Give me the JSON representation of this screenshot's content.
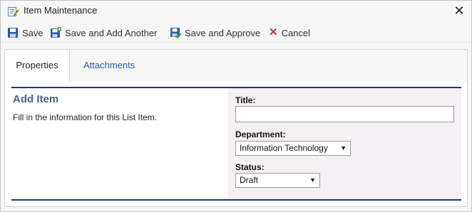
{
  "window": {
    "title": "Item Maintenance",
    "close_symbol": "✕"
  },
  "toolbar": {
    "save_label": "Save",
    "save_add_label": "Save and Add Another",
    "save_approve_label": "Save and Approve",
    "cancel_label": "Cancel",
    "cancel_symbol": "✕"
  },
  "tabs": [
    {
      "label": "Properties",
      "active": true
    },
    {
      "label": "Attachments",
      "active": false
    }
  ],
  "form": {
    "heading": "Add Item",
    "description": "Fill in the information for this List Item.",
    "fields": {
      "title": {
        "label": "Title:",
        "value": ""
      },
      "department": {
        "label": "Department:",
        "value": "Information Technology"
      },
      "status": {
        "label": "Status:",
        "value": "Draft"
      }
    }
  },
  "icons": {
    "app": "edit-form-icon",
    "save": "floppy-disk-icon",
    "save_add": "floppy-disk-plus-icon",
    "save_approve": "floppy-disk-check-icon",
    "cancel": "red-x-icon",
    "dropdown": "triangle-down-icon"
  },
  "colors": {
    "accent_link": "#1e5fa1",
    "panel_rule": "#1f3a6b",
    "heading": "#4a6189",
    "form_background": "#f6eff4",
    "cancel_red": "#d42b2b"
  }
}
